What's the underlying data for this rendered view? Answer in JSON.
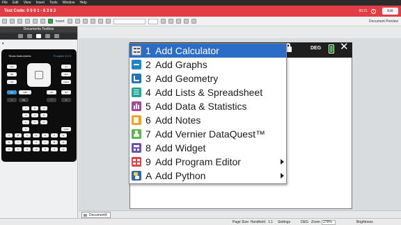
{
  "menubar": [
    "File",
    "Edit",
    "View",
    "Insert",
    "Tools",
    "Window",
    "Help"
  ],
  "testbar": {
    "code": "Test Code: 0 0 0 1 - 6 3 8 2",
    "time": "00:21",
    "exit": "Exit"
  },
  "toolbar": {
    "insert": "Insert",
    "doc_preview": "Document Preview"
  },
  "toolbox": {
    "title": "Documents Toolbox"
  },
  "calculator": {
    "brand": "Texas Instruments",
    "model": "TI-nspire CX II"
  },
  "page_header": {
    "mode": "DEG"
  },
  "menu": {
    "items": [
      {
        "num": "1",
        "label": "Add Calculator",
        "icon": "calculator-icon",
        "submenu": false,
        "selected": true
      },
      {
        "num": "2",
        "label": "Add Graphs",
        "icon": "graphs-icon",
        "submenu": false,
        "selected": false
      },
      {
        "num": "3",
        "label": "Add Geometry",
        "icon": "geometry-icon",
        "submenu": false,
        "selected": false
      },
      {
        "num": "4",
        "label": "Add Lists & Spreadsheet",
        "icon": "spreadsheet-icon",
        "submenu": false,
        "selected": false
      },
      {
        "num": "5",
        "label": "Add Data & Statistics",
        "icon": "statistics-icon",
        "submenu": false,
        "selected": false
      },
      {
        "num": "6",
        "label": "Add Notes",
        "icon": "notes-icon",
        "submenu": false,
        "selected": false
      },
      {
        "num": "7",
        "label": "Add Vernier DataQuest™",
        "icon": "vernier-icon",
        "submenu": false,
        "selected": false
      },
      {
        "num": "8",
        "label": "Add Widget",
        "icon": "widget-icon",
        "submenu": false,
        "selected": false
      },
      {
        "num": "9",
        "label": "Add Program Editor",
        "icon": "program-editor-icon",
        "submenu": true,
        "selected": false
      },
      {
        "num": "A",
        "label": "Add Python",
        "icon": "python-icon",
        "submenu": true,
        "selected": false
      }
    ]
  },
  "tabbar": {
    "doc_tab": "Document4"
  },
  "statusbar": {
    "page_size": "Page Size: Handheld",
    "page_num": "1.1",
    "settings": "Settings",
    "angle": "DEG",
    "zoom_label": "Zoom",
    "zoom_value": "278%",
    "brightness": "Brightness"
  }
}
